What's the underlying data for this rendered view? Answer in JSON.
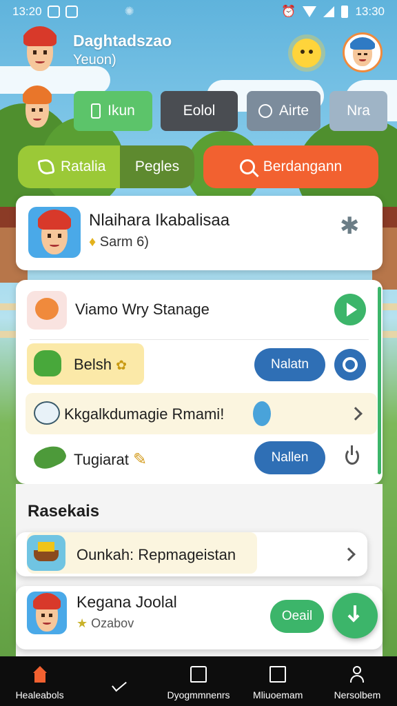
{
  "status_bar": {
    "time_left": "13:20",
    "time_right": "13:30"
  },
  "header": {
    "title": "Daghtadszao",
    "subtitle": "Yeuon)"
  },
  "quick_buttons": [
    {
      "label": "Ikun",
      "icon": "phone-icon",
      "color": "#5cc46a"
    },
    {
      "label": "Eolol",
      "icon": "",
      "color": "#4a4d52"
    },
    {
      "label": "Airte",
      "icon": "tool-icon",
      "color": "#7c8c9c"
    },
    {
      "label": "Nra",
      "icon": "",
      "color": "#9fb4c6"
    }
  ],
  "actions": {
    "left_a": "Ratalia",
    "left_b": "Pegles",
    "search": "Berdangann"
  },
  "profile_card": {
    "name": "Nlaihara Ikabalisaa",
    "meta": "Sarm 6)"
  },
  "list": [
    {
      "label": "Viamo Wry Stanage",
      "icon": "chat-icon",
      "action": "play"
    },
    {
      "label": "Belsh",
      "icon": "frog-icon",
      "button": "Nalatn"
    },
    {
      "label": "Kkgalkdumagie Rmami!",
      "icon": "cloud-icon",
      "action": "chevron"
    },
    {
      "label": "Tugiarat",
      "icon": "dino-icon",
      "button": "Nallen"
    }
  ],
  "section": {
    "title": "Rasekais"
  },
  "recent": [
    {
      "label": "Ounkah: Repmageistan",
      "icon": "boat-icon"
    },
    {
      "label": "Kegana Joolal",
      "meta": "Ozabov",
      "button": "Oeail"
    }
  ],
  "bottom_nav": [
    {
      "label": "Healeabols",
      "icon": "home-icon",
      "active": true
    },
    {
      "label": "",
      "icon": "check-icon"
    },
    {
      "label": "Dyogmmnenrs",
      "icon": "house-icon"
    },
    {
      "label": "Mliuoemam",
      "icon": "message-icon"
    },
    {
      "label": "Nersolbem",
      "icon": "user-icon"
    }
  ],
  "colors": {
    "green": "#3cb56a",
    "blue": "#2f6fb5",
    "orange": "#f26130",
    "lime": "#9bc937",
    "olive": "#5e8a2f"
  }
}
